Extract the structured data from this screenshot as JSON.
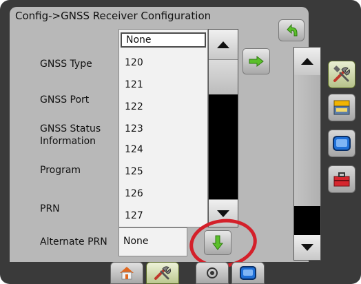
{
  "header": {
    "title": "Config->GNSS Receiver Configuration"
  },
  "labels": {
    "gnss_type": "GNSS Type",
    "gnss_port": "GNSS Port",
    "gnss_status_line1": "GNSS Status",
    "gnss_status_line2": "Information",
    "program": "Program",
    "prn": "PRN",
    "alternate_prn": "Alternate PRN"
  },
  "dropdown": {
    "selected": "None",
    "options": [
      "120",
      "121",
      "122",
      "123",
      "124",
      "125",
      "126",
      "127"
    ]
  },
  "alternate_prn": {
    "value": "None"
  },
  "colors": {
    "highlight_circle": "#d4202a",
    "arrow_green": "#5bbf2a",
    "panel": "#b8b8b8"
  },
  "icons": {
    "back": "back-arrow-icon",
    "next": "right-arrow-icon",
    "dropdown": "down-arrow-icon",
    "side_tabs": [
      "tools-icon",
      "console-icon",
      "display-icon",
      "toolbox-icon"
    ],
    "bottom_tabs": [
      "home-icon",
      "tools-icon",
      "gps-icon",
      "display-icon"
    ]
  }
}
